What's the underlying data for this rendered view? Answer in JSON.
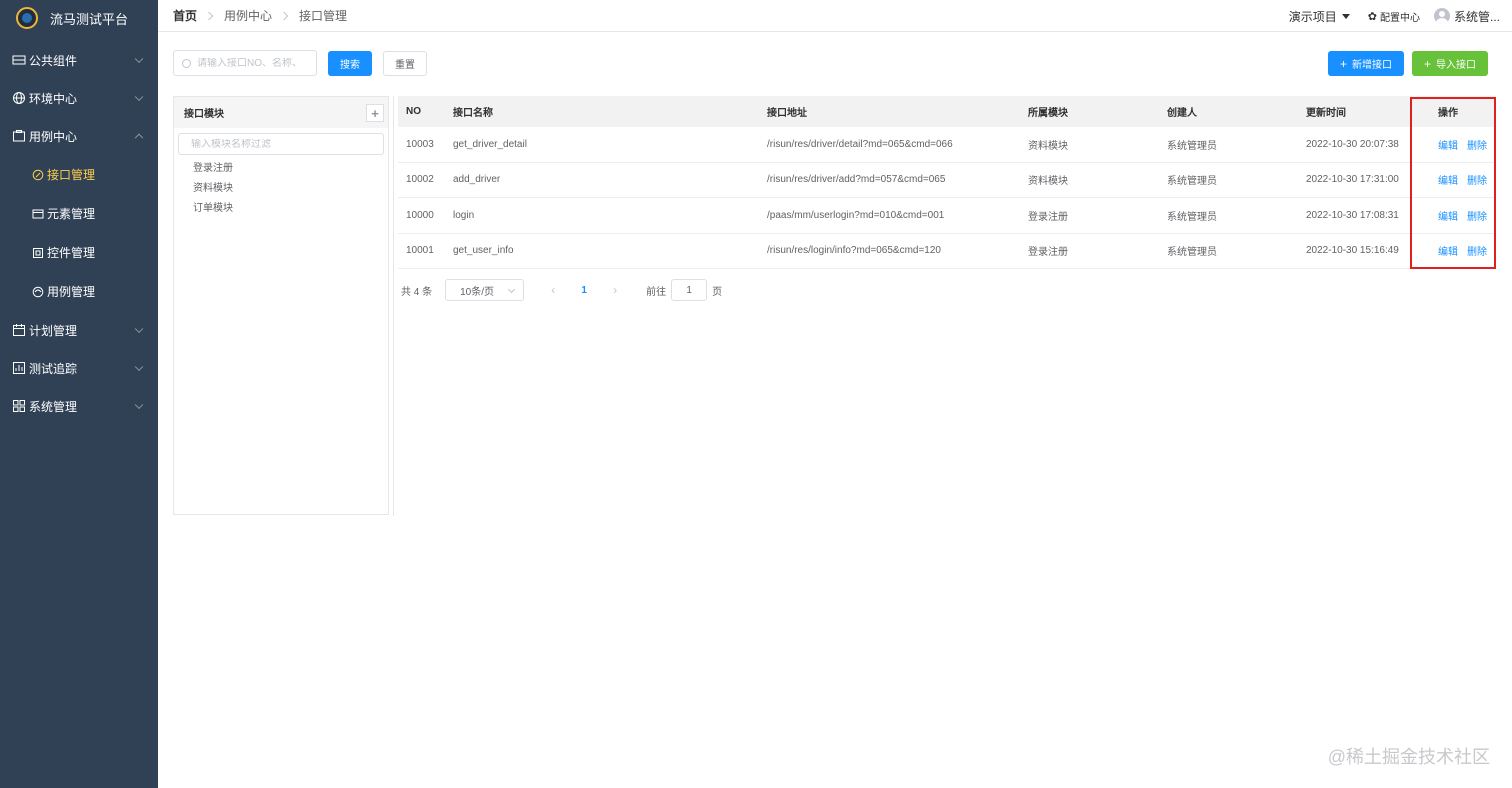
{
  "app": {
    "title": "流马测试平台"
  },
  "sidebar": {
    "items": [
      {
        "label": "公共组件",
        "icon": "component-icon",
        "expanded": false
      },
      {
        "label": "环境中心",
        "icon": "globe-icon",
        "expanded": false
      },
      {
        "label": "用例中心",
        "icon": "case-icon",
        "expanded": true,
        "children": [
          {
            "label": "接口管理",
            "icon": "api-icon",
            "active": true
          },
          {
            "label": "元素管理",
            "icon": "element-icon",
            "active": false
          },
          {
            "label": "控件管理",
            "icon": "control-icon",
            "active": false
          },
          {
            "label": "用例管理",
            "icon": "case-manage-icon",
            "active": false
          }
        ]
      },
      {
        "label": "计划管理",
        "icon": "calendar-icon",
        "expanded": false
      },
      {
        "label": "测试追踪",
        "icon": "tracking-icon",
        "expanded": false
      },
      {
        "label": "系统管理",
        "icon": "grid-icon",
        "expanded": false
      }
    ]
  },
  "header": {
    "breadcrumb": [
      "首页",
      "用例中心",
      "接口管理"
    ],
    "project": "演示项目",
    "config": "配置中心",
    "user": "系统管..."
  },
  "toolbar": {
    "search_placeholder": "请输入接口NO、名称、",
    "search_label": "搜索",
    "reset_label": "重置",
    "add_label": "新增接口",
    "import_label": "导入接口"
  },
  "modules": {
    "title": "接口模块",
    "filter_placeholder": "输入模块名称过滤",
    "nodes": [
      "登录注册",
      "资料模块",
      "订单模块"
    ]
  },
  "table": {
    "headers": [
      "NO",
      "接口名称",
      "接口地址",
      "所属模块",
      "创建人",
      "更新时间",
      "操作"
    ],
    "rows": [
      {
        "no": "10003",
        "name": "get_driver_detail",
        "url": "/risun/res/driver/detail?md=065&cmd=066",
        "module": "资料模块",
        "creator": "系统管理员",
        "time": "2022-10-30 20:07:38"
      },
      {
        "no": "10002",
        "name": "add_driver",
        "url": "/risun/res/driver/add?md=057&cmd=065",
        "module": "资料模块",
        "creator": "系统管理员",
        "time": "2022-10-30 17:31:00"
      },
      {
        "no": "10000",
        "name": "login",
        "url": "/paas/mm/userlogin?md=010&cmd=001",
        "module": "登录注册",
        "creator": "系统管理员",
        "time": "2022-10-30 17:08:31"
      },
      {
        "no": "10001",
        "name": "get_user_info",
        "url": "/risun/res/login/info?md=065&cmd=120",
        "module": "登录注册",
        "creator": "系统管理员",
        "time": "2022-10-30 15:16:49"
      }
    ],
    "edit_label": "编辑",
    "delete_label": "删除"
  },
  "pagination": {
    "total": "共 4 条",
    "page_size": "10条/页",
    "current_page": "1",
    "goto_label": "前往",
    "goto_value": "1",
    "page_suffix": "页"
  },
  "watermark": "@稀土掘金技术社区",
  "colors": {
    "sidebar_bg": "#304156",
    "primary": "#1890ff",
    "success": "#67c23a",
    "active_menu": "#ffd04b",
    "highlight": "#e02020"
  }
}
